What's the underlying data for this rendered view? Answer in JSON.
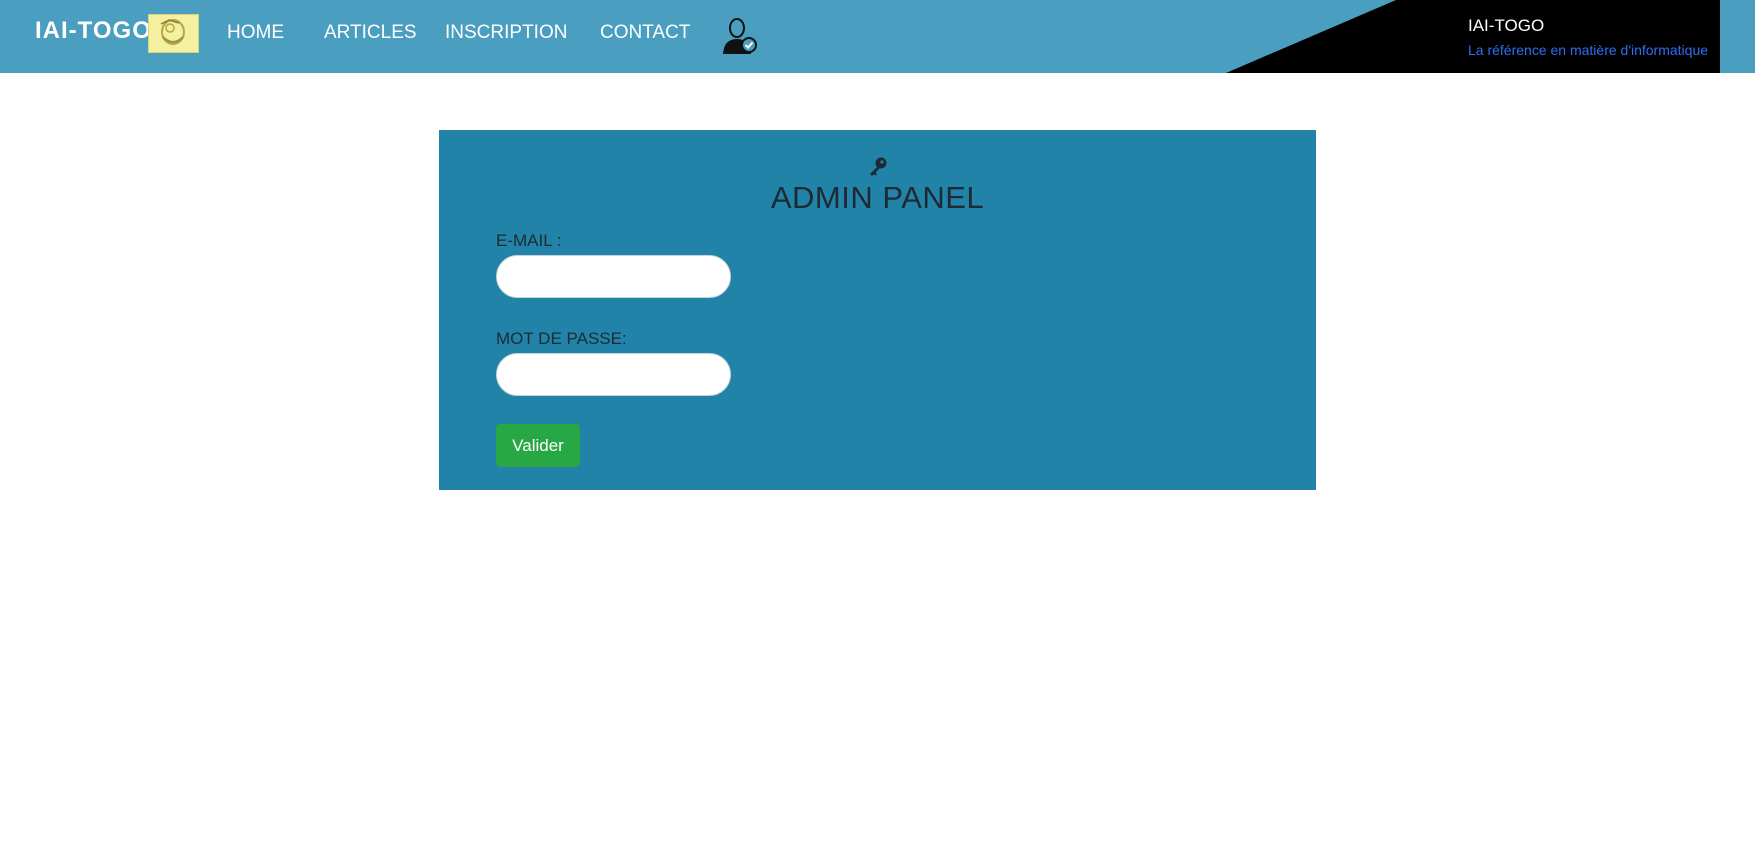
{
  "navbar": {
    "brand": "IAI-TOGO",
    "brand_logo_icon": "iai-logo-icon",
    "links": [
      "HOME",
      "ARTICLES",
      "INSCRIPTION",
      "CONTACT"
    ],
    "user_icon": "admin-user-icon",
    "corner": {
      "title": "IAI-TOGO",
      "subtitle": "La référence en matière d'informatique"
    },
    "colors": {
      "bar": "#4a9ebf",
      "corner": "#000000",
      "subtitle": "#2e6ef0"
    }
  },
  "panel": {
    "icon": "key-icon",
    "title": "ADMIN PANEL",
    "email_label": "E-MAIL :",
    "email_value": "",
    "password_label": "MOT DE PASSE:",
    "password_value": "",
    "submit_label": "Valider",
    "colors": {
      "background": "#2283a8",
      "button": "#28a745"
    }
  }
}
